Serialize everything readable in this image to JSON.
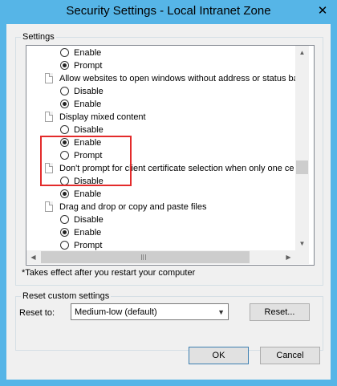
{
  "window": {
    "title": "Security Settings - Local Intranet Zone",
    "close_glyph": "✕"
  },
  "settings": {
    "group_label": "Settings",
    "items": [
      {
        "type": "option",
        "label": "Enable",
        "checked": false
      },
      {
        "type": "option",
        "label": "Prompt",
        "checked": true
      },
      {
        "type": "setting",
        "label": "Allow websites to open windows without address or status ba"
      },
      {
        "type": "option",
        "label": "Disable",
        "checked": false
      },
      {
        "type": "option",
        "label": "Enable",
        "checked": true
      },
      {
        "type": "setting",
        "label": "Display mixed content"
      },
      {
        "type": "option",
        "label": "Disable",
        "checked": false
      },
      {
        "type": "option",
        "label": "Enable",
        "checked": true
      },
      {
        "type": "option",
        "label": "Prompt",
        "checked": false
      },
      {
        "type": "setting",
        "label": "Don't prompt for client certificate selection when only one ce"
      },
      {
        "type": "option",
        "label": "Disable",
        "checked": false
      },
      {
        "type": "option",
        "label": "Enable",
        "checked": true
      },
      {
        "type": "setting",
        "label": "Drag and drop or copy and paste files"
      },
      {
        "type": "option",
        "label": "Disable",
        "checked": false
      },
      {
        "type": "option",
        "label": "Enable",
        "checked": true
      },
      {
        "type": "option",
        "label": "Prompt",
        "checked": false
      }
    ],
    "footnote": "*Takes effect after you restart your computer"
  },
  "reset": {
    "group_label": "Reset custom settings",
    "reset_to_label": "Reset to:",
    "selected": "Medium-low (default)",
    "reset_button": "Reset..."
  },
  "buttons": {
    "ok": "OK",
    "cancel": "Cancel"
  },
  "colors": {
    "frame": "#56b5e7",
    "highlight": "#e32b2b"
  }
}
